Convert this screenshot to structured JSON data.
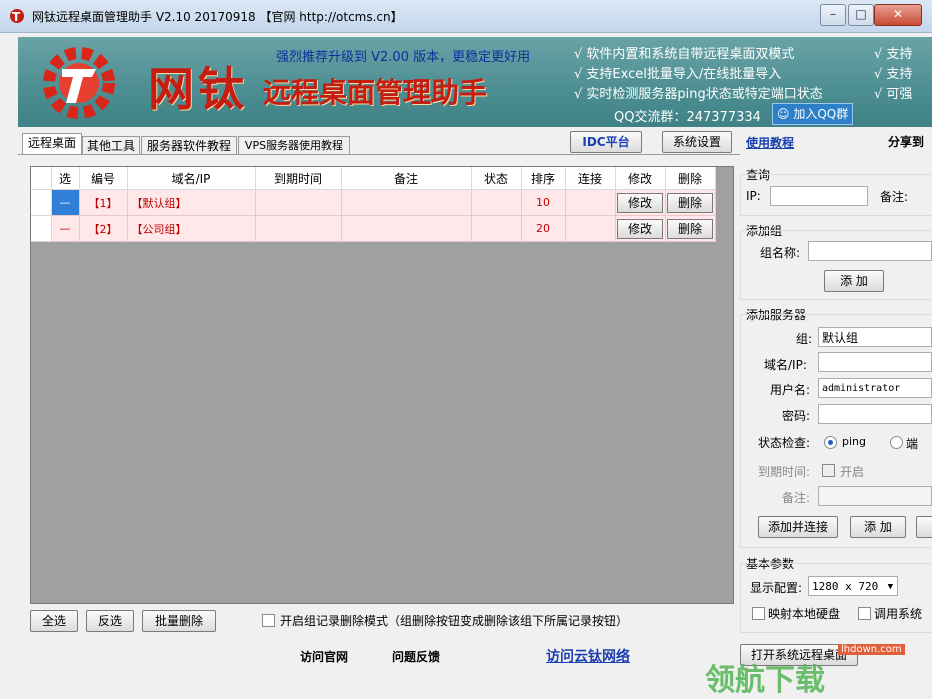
{
  "window": {
    "title": "网钛远程桌面管理助手 V2.10 20170918 【官网 http://otcms.cn】",
    "controls": [
      "–",
      "□",
      "✕"
    ]
  },
  "banner": {
    "logo_main": "网钛",
    "logo_sub": "远程桌面管理助手",
    "promo": "强烈推荐升级到 V2.00 版本，更稳定更好用",
    "features": [
      "√ 软件内置和系统自带远程桌面双模式",
      "√ 支持Excel批量导入/在线批量导入",
      "√ 实时检测服务器ping状态或特定端口状态"
    ],
    "features_right": [
      "√ 支持",
      "√ 支持",
      "√ 可强"
    ],
    "qq_label": "QQ交流群：247377334",
    "qq_button": "加入QQ群"
  },
  "tabs": [
    "远程桌面",
    "其他工具",
    "服务器软件教程",
    "VPS服务器使用教程"
  ],
  "toolbar": {
    "idc": "IDC平台",
    "settings": "系统设置",
    "help": "使用教程",
    "share": "分享到"
  },
  "table": {
    "headers": [
      "选",
      "编号",
      "域名/IP",
      "到期时间",
      "备注",
      "状态",
      "排序",
      "连接",
      "修改",
      "删除"
    ],
    "rows": [
      {
        "sel": "—",
        "id": "【1】",
        "name": "【默认组】",
        "expire": "",
        "note": "",
        "status": "",
        "order": "10",
        "connect": "",
        "edit": "修改",
        "delete": "删除"
      },
      {
        "sel": "—",
        "id": "【2】",
        "name": "【公司组】",
        "expire": "",
        "note": "",
        "status": "",
        "order": "20",
        "connect": "",
        "edit": "修改",
        "delete": "删除"
      }
    ]
  },
  "bottom": {
    "select_all": "全选",
    "invert": "反选",
    "batch_delete": "批量删除",
    "group_delete_mode": "开启组记录删除模式（组删除按钮变成删除该组下所属记录按钮）"
  },
  "side": {
    "query": {
      "title": "查询",
      "ip_label": "IP:",
      "note_label": "备注:"
    },
    "add_group": {
      "title": "添加组",
      "name_label": "组名称:",
      "add": "添 加"
    },
    "add_server": {
      "title": "添加服务器",
      "group_label": "组:",
      "group_value": "默认组",
      "domain_label": "域名/IP:",
      "user_label": "用户名:",
      "user_value": "administrator",
      "pwd_label": "密码:",
      "check_label": "状态检查:",
      "ping": "ping",
      "port": "端",
      "expire_label": "到期时间:",
      "enable": "开启",
      "note_label": "备注:",
      "add_connect": "添加并连接",
      "add": "添 加"
    },
    "basic": {
      "title": "基本参数",
      "display_label": "显示配置:",
      "display_value": "1280 x 720",
      "map_disk": "映射本地硬盘",
      "use_system": "调用系统"
    }
  },
  "footer": {
    "visit_site": "访问官网",
    "feedback": "问题反馈",
    "cloud": "访问云钛网络",
    "open_remote": "打开系统远程桌面"
  },
  "watermark": {
    "text": "领航下载",
    "url": "lhdown.com"
  },
  "colors": {
    "banner": "#4c8e92",
    "logo_red": "#c61d12",
    "link_blue": "#1a3fb0",
    "row_pink": "#ffe8ea",
    "selected_blue": "#2f7fd6"
  }
}
